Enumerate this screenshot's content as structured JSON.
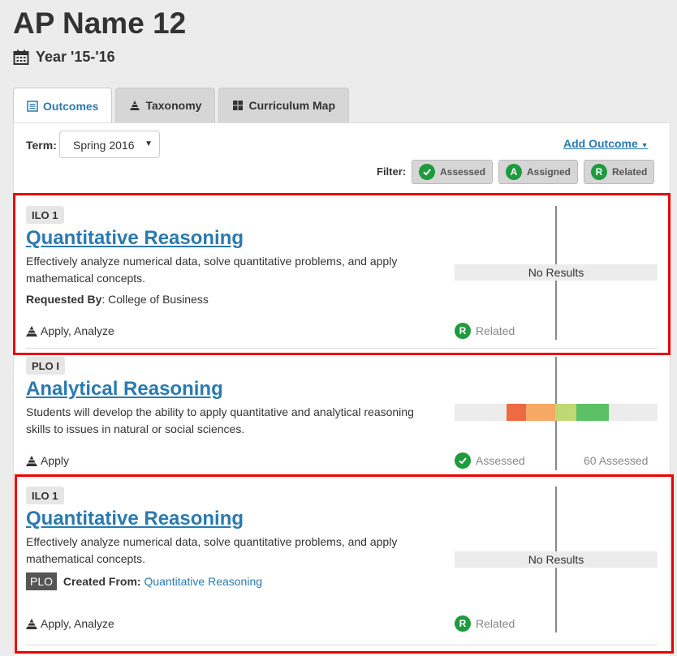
{
  "page": {
    "title": "AP Name 12",
    "year": "Year '15-'16"
  },
  "tabs": [
    {
      "label": "Outcomes",
      "active": true
    },
    {
      "label": "Taxonomy",
      "active": false
    },
    {
      "label": "Curriculum Map",
      "active": false
    }
  ],
  "toolbar": {
    "term_label": "Term:",
    "term_value": "Spring 2016",
    "add_outcome": "Add Outcome",
    "filter_label": "Filter:",
    "filters": [
      {
        "label": "Assessed",
        "icon": "check"
      },
      {
        "label": "Assigned",
        "icon": "A"
      },
      {
        "label": "Related",
        "icon": "R"
      }
    ]
  },
  "outcomes": [
    {
      "badge": "ILO 1",
      "title": "Quantitative Reasoning",
      "description": "Effectively analyze numerical data, solve quantitative problems, and apply mathematical concepts.",
      "meta_label": "Requested By",
      "meta_value": "College of Business",
      "taxonomy": "Apply, Analyze",
      "results": "No Results",
      "status_icon": "R",
      "status": "Related"
    },
    {
      "badge": "PLO I",
      "title": "Analytical Reasoning",
      "description": "Students will develop the ability to apply quantitative and analytical reasoning skills to issues in natural or social sciences.",
      "taxonomy": "Apply",
      "status_icon": "check",
      "status": "Assessed",
      "count": "60 Assessed"
    },
    {
      "badge": "ILO 1",
      "title": "Quantitative Reasoning",
      "description": "Effectively analyze numerical data, solve quantitative problems, and apply mathematical concepts.",
      "plo_tag": "PLO",
      "meta_label": "Created From:",
      "meta_link": "Quantitative Reasoning",
      "taxonomy": "Apply, Analyze",
      "results": "No Results",
      "status_icon": "R",
      "status": "Related"
    }
  ],
  "colors": {
    "accent": "#2a7ab0",
    "status_green": "#1e9b3f",
    "highlight_red": "#e00000",
    "dist_segments": [
      "#ee6a44",
      "#f6a864",
      "#c0d873",
      "#5cc066"
    ]
  }
}
